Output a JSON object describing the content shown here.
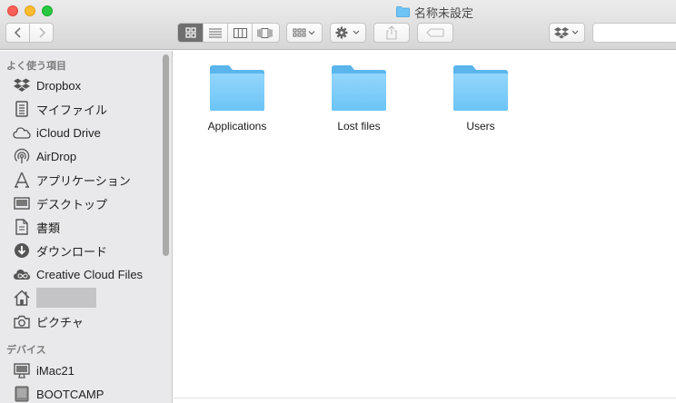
{
  "window": {
    "title": "名称未設定"
  },
  "toolbar": {
    "back": "back-chevron",
    "forward": "forward-chevron",
    "view_modes": [
      "icon-view",
      "list-view",
      "column-view",
      "coverflow-view"
    ],
    "active_view": "icon-view"
  },
  "sidebar": {
    "favorites_header": "よく使う項目",
    "favorites": [
      {
        "label": "Dropbox",
        "icon": "dropbox-icon"
      },
      {
        "label": "マイファイル",
        "icon": "all-files-icon"
      },
      {
        "label": "iCloud Drive",
        "icon": "cloud-icon"
      },
      {
        "label": "AirDrop",
        "icon": "airdrop-icon"
      },
      {
        "label": "アプリケーション",
        "icon": "applications-icon"
      },
      {
        "label": "デスクトップ",
        "icon": "desktop-icon"
      },
      {
        "label": "書類",
        "icon": "documents-icon"
      },
      {
        "label": "ダウンロード",
        "icon": "downloads-icon"
      },
      {
        "label": "Creative Cloud Files",
        "icon": "creative-cloud-icon"
      },
      {
        "label": "",
        "icon": "home-icon"
      },
      {
        "label": "ピクチャ",
        "icon": "camera-icon"
      }
    ],
    "devices_header": "デバイス",
    "devices": [
      {
        "label": "iMac21",
        "icon": "imac-icon"
      },
      {
        "label": "BOOTCAMP",
        "icon": "disk-icon"
      }
    ]
  },
  "content": {
    "items": [
      {
        "name": "Applications"
      },
      {
        "name": "Lost files"
      },
      {
        "name": "Users"
      }
    ]
  },
  "colors": {
    "folder_light": "#8fd3fb",
    "folder_dark": "#5ab5ec",
    "sidebar_bg": "#e9e9eb"
  }
}
